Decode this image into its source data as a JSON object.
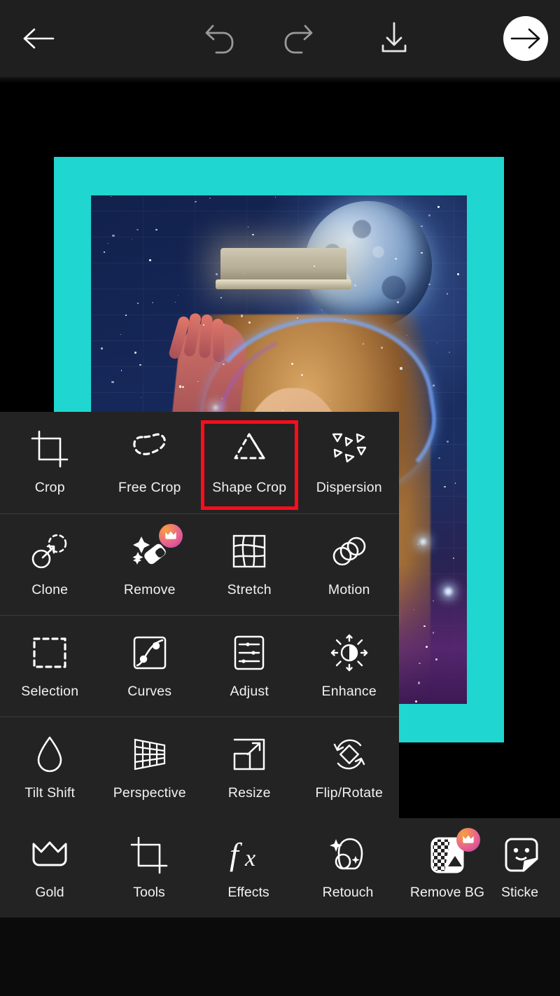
{
  "app": {
    "theme": {
      "panel_bg": "#232323",
      "canvas_bg": "#000000",
      "accent_cyan": "#20D6D0",
      "selection_red": "#FC0D1B",
      "label_color": "#F2F2F2",
      "badge_gradient_from": "#F7A03C",
      "badge_gradient_to": "#C13CA0"
    }
  },
  "topbar": {
    "buttons": [
      {
        "name": "back-button",
        "icon": "arrow-left-icon"
      },
      {
        "name": "undo-button",
        "icon": "undo-icon"
      },
      {
        "name": "redo-button",
        "icon": "redo-icon"
      },
      {
        "name": "save-button",
        "icon": "download-icon"
      },
      {
        "name": "next-button",
        "icon": "arrow-right-icon"
      }
    ]
  },
  "canvas": {
    "frame_color": "#20D6D0",
    "photo_description": "Woman with curly hair against a starry brick wall with a large moon"
  },
  "tools_panel": {
    "selected": "Shape Crop",
    "rows": [
      [
        {
          "label": "Crop",
          "icon": "crop-icon",
          "badge": false
        },
        {
          "label": "Free Crop",
          "icon": "free-crop-icon",
          "badge": false
        },
        {
          "label": "Shape Crop",
          "icon": "shape-crop-icon",
          "badge": false
        },
        {
          "label": "Dispersion",
          "icon": "dispersion-icon",
          "badge": false
        }
      ],
      [
        {
          "label": "Clone",
          "icon": "clone-icon",
          "badge": false
        },
        {
          "label": "Remove",
          "icon": "remove-eraser-icon",
          "badge": true,
          "badge_icon": "crown-icon"
        },
        {
          "label": "Stretch",
          "icon": "stretch-grid-icon",
          "badge": false
        },
        {
          "label": "Motion",
          "icon": "motion-icon",
          "badge": false
        }
      ],
      [
        {
          "label": "Selection",
          "icon": "selection-icon",
          "badge": false
        },
        {
          "label": "Curves",
          "icon": "curves-icon",
          "badge": false
        },
        {
          "label": "Adjust",
          "icon": "adjust-sliders-icon",
          "badge": false
        },
        {
          "label": "Enhance",
          "icon": "enhance-icon",
          "badge": false
        }
      ],
      [
        {
          "label": "Tilt Shift",
          "icon": "tilt-shift-drop-icon",
          "badge": false
        },
        {
          "label": "Perspective",
          "icon": "perspective-icon",
          "badge": false
        },
        {
          "label": "Resize",
          "icon": "resize-icon",
          "badge": false
        },
        {
          "label": "Flip/Rotate",
          "icon": "flip-rotate-icon",
          "badge": false
        }
      ]
    ]
  },
  "bottom_nav": {
    "items": [
      {
        "label": "Gold",
        "icon": "crown-icon",
        "badge": false
      },
      {
        "label": "Tools",
        "icon": "crop-icon",
        "badge": false
      },
      {
        "label": "Effects",
        "icon": "fx-icon",
        "badge": false
      },
      {
        "label": "Retouch",
        "icon": "retouch-face-icon",
        "badge": false
      },
      {
        "label": "Remove BG",
        "icon": "remove-bg-icon",
        "badge": true,
        "badge_icon": "crown-icon"
      },
      {
        "label": "Sticke",
        "icon": "sticker-icon",
        "badge": false,
        "clipped": true
      }
    ]
  }
}
